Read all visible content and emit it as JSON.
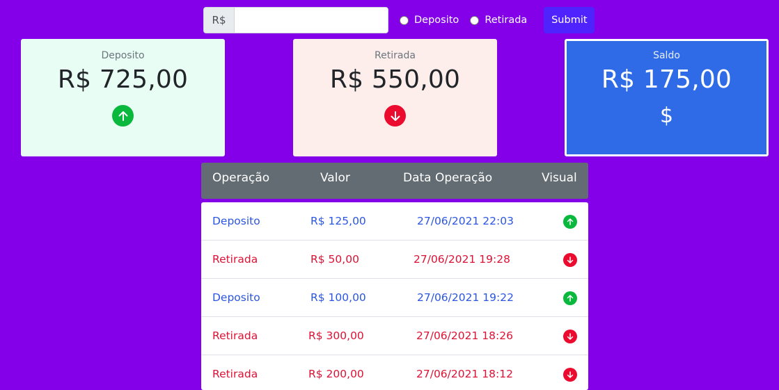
{
  "form": {
    "currency": "R$",
    "amount_value": "",
    "option_deposito": "Deposito",
    "option_retirada": "Retirada",
    "submit_label": "Submit"
  },
  "cards": {
    "deposito": {
      "label": "Deposito",
      "amount": "R$ 725,00",
      "icon": "arrow-up-icon"
    },
    "retirada": {
      "label": "Retirada",
      "amount": "R$ 550,00",
      "icon": "arrow-down-icon"
    },
    "saldo": {
      "label": "Saldo",
      "amount": "R$ 175,00",
      "symbol": "$"
    }
  },
  "table": {
    "headers": [
      "Operação",
      "Valor",
      "Data Operação",
      "Visual"
    ],
    "rows": [
      {
        "op": "Deposito",
        "valor": "R$ 125,00",
        "data": "27/06/2021 22:03",
        "type": "deposito"
      },
      {
        "op": "Retirada",
        "valor": "R$ 50,00",
        "data": "27/06/2021 19:28",
        "type": "retirada"
      },
      {
        "op": "Deposito",
        "valor": "R$ 100,00",
        "data": "27/06/2021 19:22",
        "type": "deposito"
      },
      {
        "op": "Retirada",
        "valor": "R$ 300,00",
        "data": "27/06/2021 18:26",
        "type": "retirada"
      },
      {
        "op": "Retirada",
        "valor": "R$ 200,00",
        "data": "27/06/2021 18:12",
        "type": "retirada"
      }
    ]
  },
  "colors": {
    "background": "#8300e9",
    "deposito": "#2b55e3",
    "retirada": "#dc1235",
    "up_icon": "#09b83d",
    "down_icon": "#ea0b2e",
    "saldo_card": "#2f6be6"
  }
}
